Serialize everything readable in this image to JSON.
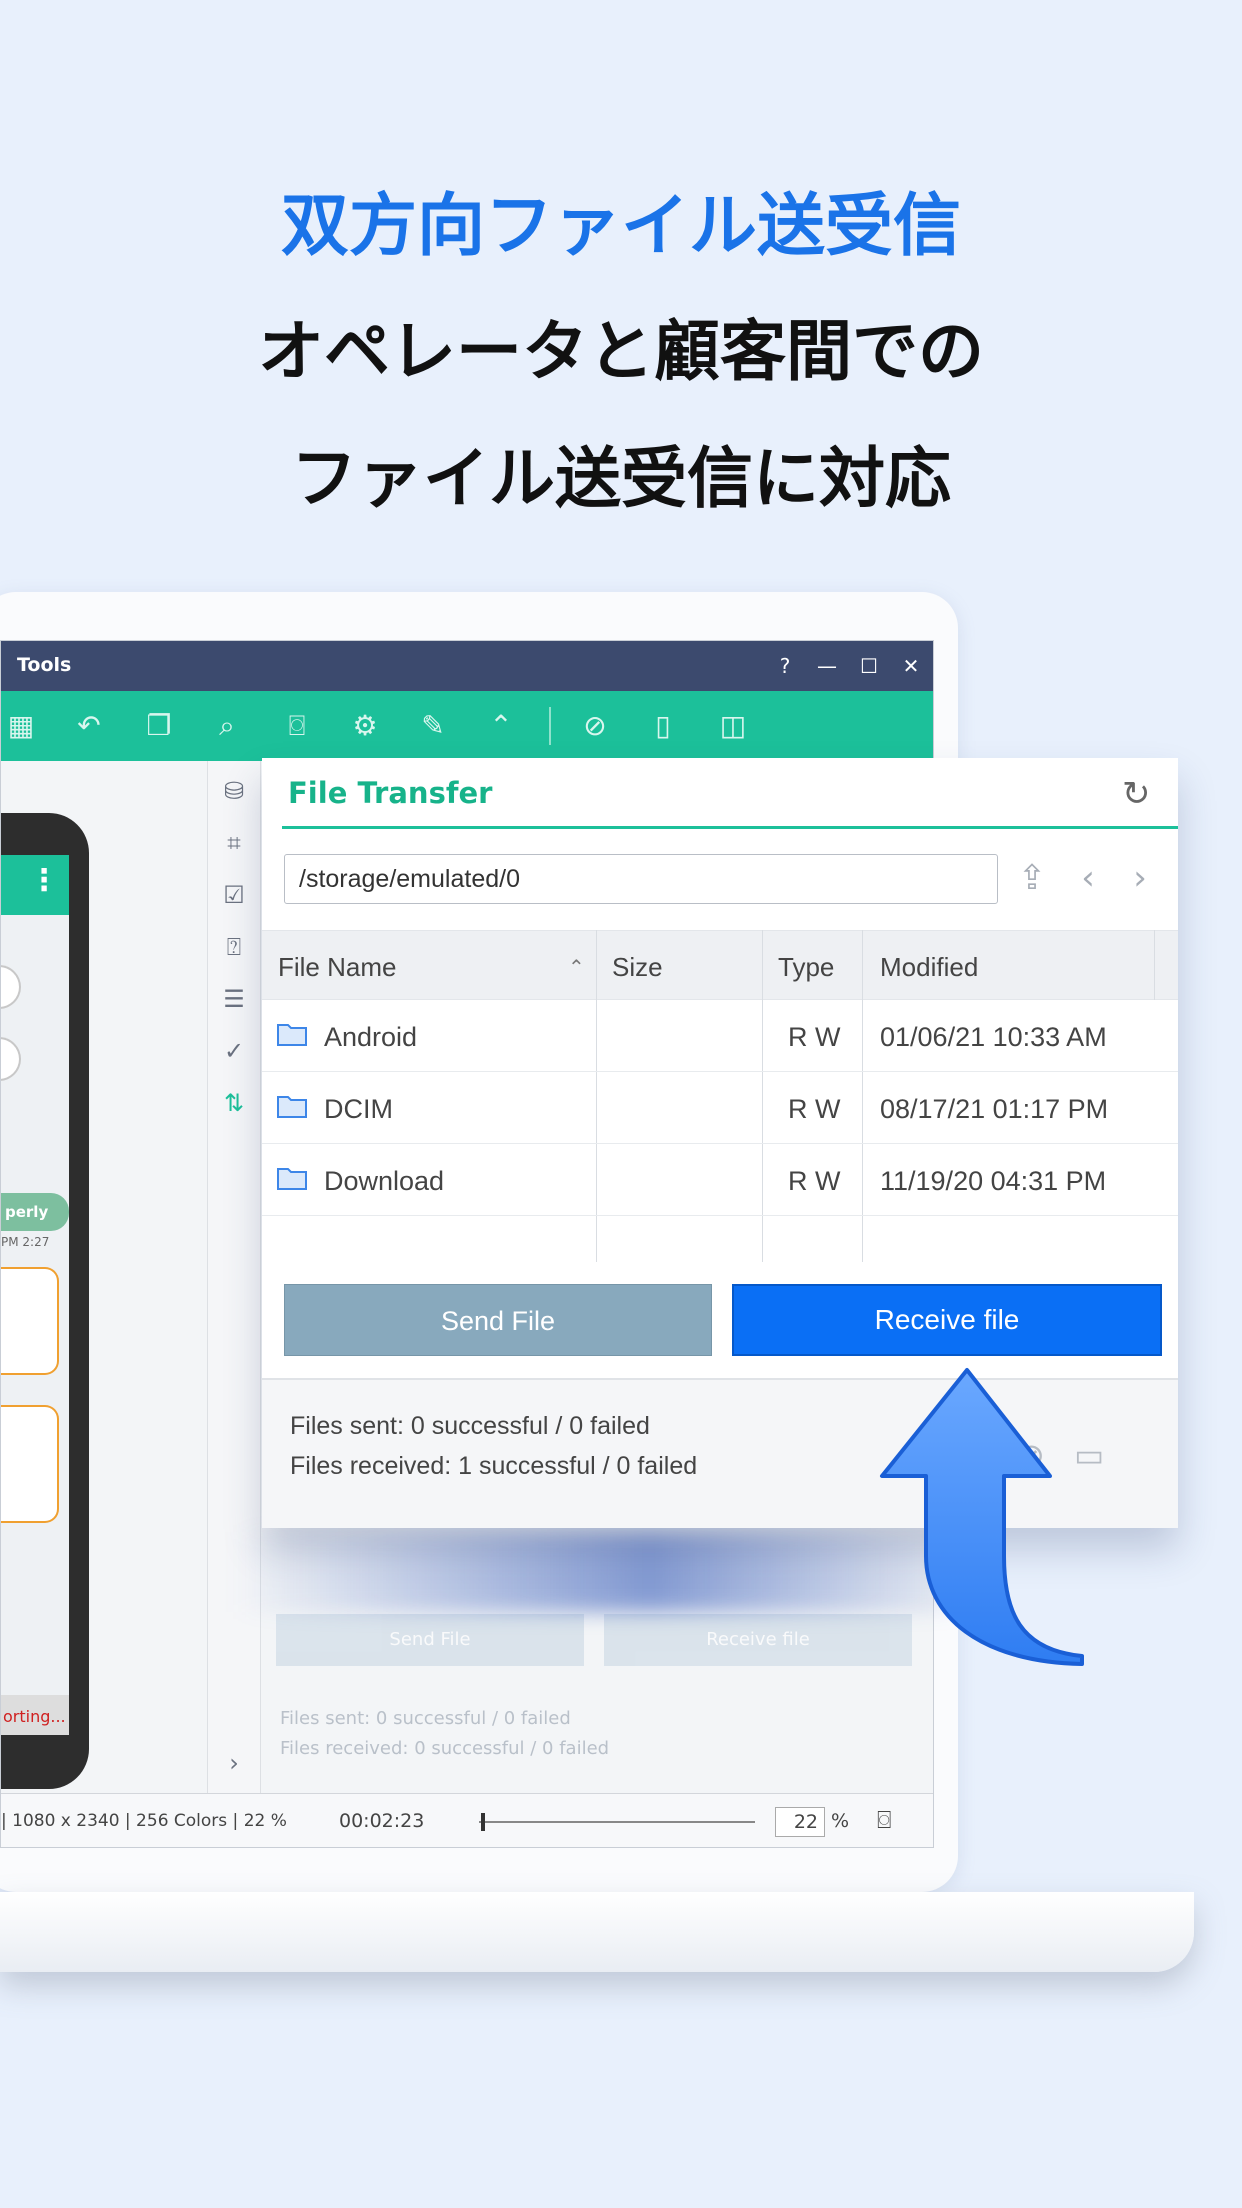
{
  "headline": {
    "line1": "双方向ファイル送受信",
    "line2": "オペレータと顧客間での",
    "line3": "ファイル送受信に対応"
  },
  "window": {
    "title": "Tools",
    "help": "?",
    "minimize": "—",
    "maximize": "☐",
    "close": "✕"
  },
  "phone": {
    "menu_glyph": "⋮",
    "chat_text": "perly",
    "chat_time": "PM 2:27",
    "status_text": "orting..."
  },
  "file_transfer": {
    "title": "File Transfer",
    "path": "/storage/emulated/0",
    "columns": [
      "File Name",
      "Size",
      "Type",
      "Modified"
    ],
    "rows": [
      {
        "name": "Android",
        "size": "",
        "type": "R W",
        "modified": "01/06/21 10:33 AM"
      },
      {
        "name": "DCIM",
        "size": "",
        "type": "R W",
        "modified": "08/17/21 01:17 PM"
      },
      {
        "name": "Download",
        "size": "",
        "type": "R W",
        "modified": "11/19/20 04:31 PM"
      }
    ],
    "send_label": "Send File",
    "receive_label": "Receive file",
    "files_sent": "Files sent: 0 successful / 0 failed",
    "files_received": "Files received: 1 successful / 0 failed"
  },
  "ghost": {
    "send_label": "Send File",
    "receive_label": "Receive file",
    "files_sent": "Files sent: 0 successful / 0 failed",
    "files_received": "Files received: 0 successful / 0 failed"
  },
  "statusbar": {
    "resolution": "| 1080 x 2340 | 256 Colors | 22 %",
    "elapsed": "00:02:23",
    "zoom_value": "22",
    "zoom_unit": "%"
  },
  "colors": {
    "accent_blue": "#1a73e8",
    "teal": "#1cc09a",
    "titlebar": "#3c4a6e",
    "receive_button": "#0a6ff5"
  }
}
